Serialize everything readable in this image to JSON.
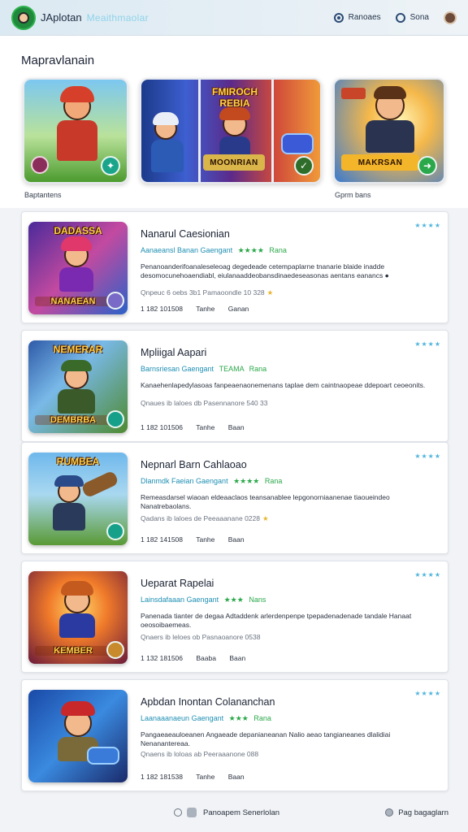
{
  "header": {
    "brand": "JAplotan",
    "brand_sub": "Meaithmaolar",
    "nav": [
      {
        "label": "Ranoaes",
        "icon": "radio-icon"
      },
      {
        "label": "Sona",
        "icon": "refresh-icon"
      }
    ],
    "avatar_icon": "user-avatar"
  },
  "featured": {
    "title": "Mapravlanain",
    "tiles": [
      {
        "caption": "Baptantens",
        "bottom_label": "",
        "top_label": ""
      },
      {
        "caption": "",
        "top_label": "FMIROCH REBIA",
        "bottom_label": "MOONRIAN"
      },
      {
        "caption": "Gprm bans",
        "top_label": "",
        "bottom_label": "MAKRSAN"
      }
    ]
  },
  "list": [
    {
      "title": "Nanarul Caesionian",
      "thumb_top": "DADASSA",
      "thumb_bottom": "NANAEAN",
      "meta": "Aanaeansl Banan Gaengant",
      "stars": "★★★★",
      "tag": "Rana",
      "desc": "Penanoanderifoanaleseleoag degedeade cetempaplarne tnanarie blaide inadde desomocunehoaendiabl, eiulanaaddeobansdinaedeseasonas aentans eanancs ●",
      "sub": "Qnpeuc 6 oebs 3b1 Pamaoondle 10 328",
      "stats": [
        "1 182 101508",
        "Tanhe",
        "Ganan"
      ],
      "rating": "★★★★"
    },
    {
      "title": "Mpliigal Aapari",
      "thumb_top": "NEMERAR",
      "thumb_bottom": "DEMBRBA",
      "meta": "Barnsriesan Gaengant",
      "stars": "TEAMA",
      "tag": "Rana",
      "desc": "Kanaehenlapedylasoas fanpeaenaonemenans taplae dem caintnaopeae ddepoart ceoeonits.",
      "sub": "Qnaues ib laloes db Pasennanore 540 33",
      "stats": [
        "1 182 101506",
        "Tanhe",
        "Baan"
      ],
      "rating": "★★★★"
    },
    {
      "title": "Nepnarl Barn Cahlaoao",
      "thumb_top": "RUMBEA",
      "thumb_bottom": "",
      "meta": "Dlanmdk Faeian Gaengant",
      "stars": "★★★★",
      "tag": "Rana",
      "desc": "Remeasdarsel wiaoan eldeaaclaos teansanablee lepgonorniaanenae tiaoueindeo Nanatrebaolans.",
      "sub": "Qadans ib laloes de Peeaaanane 0228",
      "stats": [
        "1 182 141508",
        "Tanhe",
        "Baan"
      ],
      "rating": "★★★★"
    },
    {
      "title": "Ueparat Rapelai",
      "thumb_top": "",
      "thumb_bottom": "KEMBER",
      "meta": "Lainsdafaaan Gaengant",
      "stars": "★★★",
      "tag": "Nans",
      "desc": "Panenada tianter de degaa Adtaddenk arlerdenpenpe tpepadenadenade tandale Hanaat oeosoibaemeas.",
      "sub": "Qnaers ib leloes ob Pasnaoanore 0538",
      "stats": [
        "1 132 181506",
        "Baaba",
        "Baan"
      ],
      "rating": "★★★★"
    },
    {
      "title": "Apbdan Inontan Colananchan",
      "thumb_top": "",
      "thumb_bottom": "",
      "meta": "Laanaaanaeun Gaengant",
      "stars": "★★★",
      "tag": "Rana",
      "desc": "Pangaeaeauloeanen Angaeade depanianeanan Nalio aeao tangianeanes dlalidiai Nenanantereaa.",
      "sub": "Qnaens ib loloas ab Peeraaanone 088",
      "stats": [
        "1 182 181538",
        "Tanhe",
        "Baan"
      ],
      "rating": "★★★★"
    }
  ],
  "footer": {
    "left_label": "Panoapem Senerlolan",
    "right_label": "Pag bagaglarn"
  },
  "colors": {
    "accent": "#1f8fb3",
    "star_green": "#2aa84a",
    "header_bg": "#dbe9f2"
  }
}
